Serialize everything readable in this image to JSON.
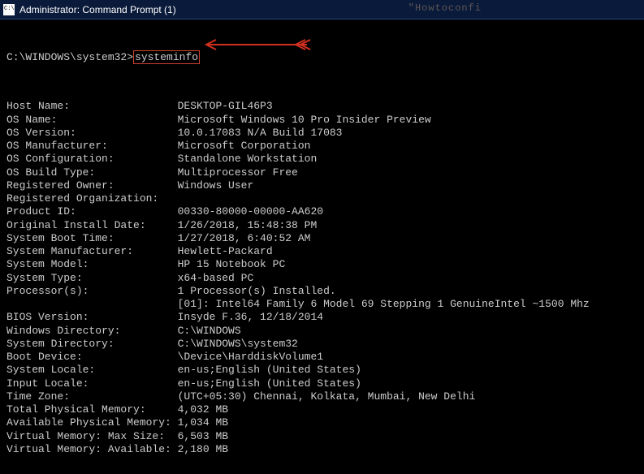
{
  "titlebar": {
    "text": "Administrator: Command Prompt (1)"
  },
  "watermark": "\"Howtoconfi",
  "prompt": {
    "path": "C:\\WINDOWS\\system32>",
    "command": "systeminfo"
  },
  "info": [
    {
      "label": "Host Name:",
      "value": "DESKTOP-GIL46P3"
    },
    {
      "label": "OS Name:",
      "value": "Microsoft Windows 10 Pro Insider Preview"
    },
    {
      "label": "OS Version:",
      "value": "10.0.17083 N/A Build 17083"
    },
    {
      "label": "OS Manufacturer:",
      "value": "Microsoft Corporation"
    },
    {
      "label": "OS Configuration:",
      "value": "Standalone Workstation"
    },
    {
      "label": "OS Build Type:",
      "value": "Multiprocessor Free"
    },
    {
      "label": "Registered Owner:",
      "value": "Windows User"
    },
    {
      "label": "Registered Organization:",
      "value": ""
    },
    {
      "label": "Product ID:",
      "value": "00330-80000-00000-AA620"
    },
    {
      "label": "Original Install Date:",
      "value": "1/26/2018, 15:48:38 PM"
    },
    {
      "label": "System Boot Time:",
      "value": "1/27/2018, 6:40:52 AM"
    },
    {
      "label": "System Manufacturer:",
      "value": "Hewlett-Packard"
    },
    {
      "label": "System Model:",
      "value": "HP 15 Notebook PC"
    },
    {
      "label": "System Type:",
      "value": "x64-based PC"
    },
    {
      "label": "Processor(s):",
      "value": "1 Processor(s) Installed."
    },
    {
      "label": "",
      "value": "[01]: Intel64 Family 6 Model 69 Stepping 1 GenuineIntel ~1500 Mhz"
    },
    {
      "label": "BIOS Version:",
      "value": "Insyde F.36, 12/18/2014"
    },
    {
      "label": "Windows Directory:",
      "value": "C:\\WINDOWS"
    },
    {
      "label": "System Directory:",
      "value": "C:\\WINDOWS\\system32"
    },
    {
      "label": "Boot Device:",
      "value": "\\Device\\HarddiskVolume1"
    },
    {
      "label": "System Locale:",
      "value": "en-us;English (United States)"
    },
    {
      "label": "Input Locale:",
      "value": "en-us;English (United States)"
    },
    {
      "label": "Time Zone:",
      "value": "(UTC+05:30) Chennai, Kolkata, Mumbai, New Delhi"
    },
    {
      "label": "Total Physical Memory:",
      "value": "4,032 MB"
    },
    {
      "label": "Available Physical Memory:",
      "value": "1,034 MB"
    },
    {
      "label": "Virtual Memory: Max Size:",
      "value": "6,503 MB"
    },
    {
      "label": "Virtual Memory: Available:",
      "value": "2,180 MB"
    }
  ]
}
